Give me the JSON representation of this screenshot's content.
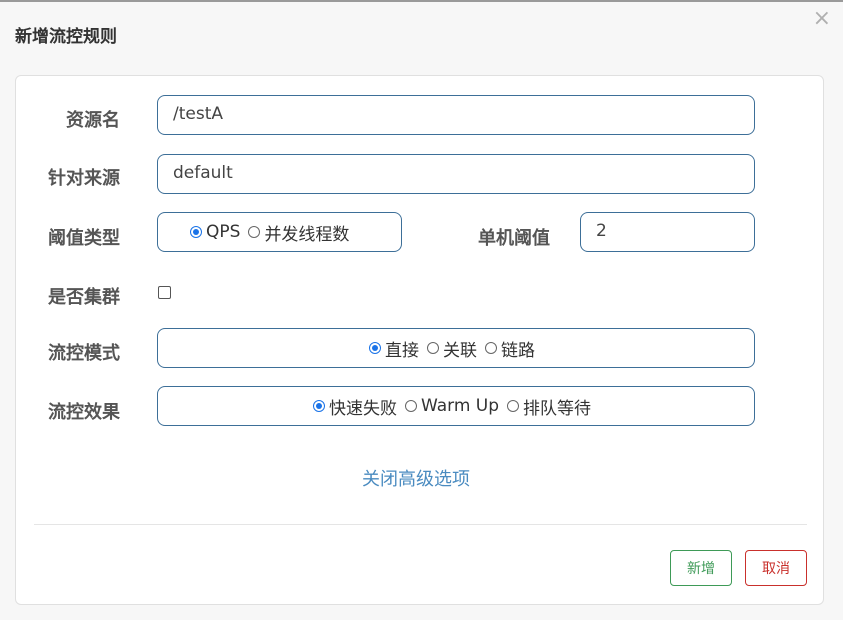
{
  "dialog": {
    "title": "新增流控规则",
    "close_glyph": "×"
  },
  "form": {
    "resource_name": {
      "label": "资源名",
      "value": "/testA"
    },
    "limit_app": {
      "label": "针对来源",
      "value": "default"
    },
    "threshold_type": {
      "label": "阈值类型",
      "options": [
        {
          "label": "QPS",
          "checked": true
        },
        {
          "label": "并发线程数",
          "checked": false
        }
      ]
    },
    "single_threshold": {
      "label": "单机阈值",
      "value": "2"
    },
    "cluster": {
      "label": "是否集群",
      "checked": false
    },
    "flow_mode": {
      "label": "流控模式",
      "options": [
        {
          "label": "直接",
          "checked": true
        },
        {
          "label": "关联",
          "checked": false
        },
        {
          "label": "链路",
          "checked": false
        }
      ]
    },
    "flow_effect": {
      "label": "流控效果",
      "options": [
        {
          "label": "快速失败",
          "checked": true
        },
        {
          "label": "Warm Up",
          "checked": false
        },
        {
          "label": "排队等待",
          "checked": false
        }
      ]
    },
    "advanced_toggle": "关闭高级选项"
  },
  "footer": {
    "add_label": "新增",
    "cancel_label": "取消"
  },
  "colors": {
    "field_border": "#3d6f98",
    "radio_checked": "#1a73e8",
    "link": "#4a8bc0",
    "add_button": "#3e9a57",
    "cancel_button": "#c9302c"
  }
}
